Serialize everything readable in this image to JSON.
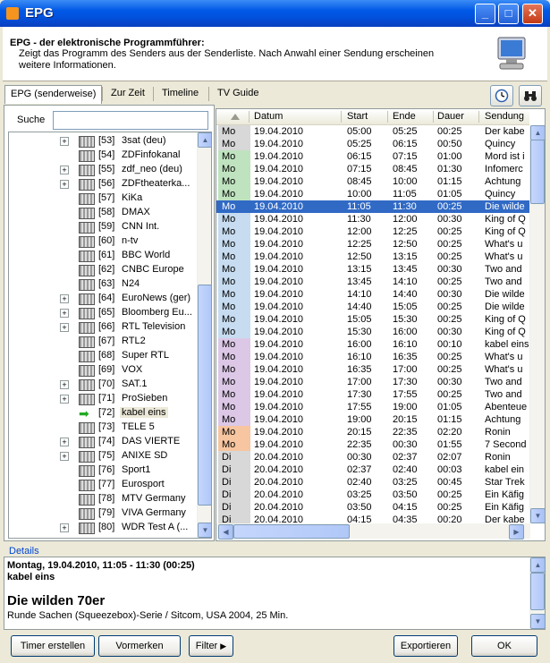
{
  "window": {
    "title": "EPG",
    "minimize": "_",
    "maximize": "□",
    "close": "✕"
  },
  "header": {
    "title": "EPG - der elektronische Programmführer:",
    "description": "Zeigt das Programm des Senders aus der Senderliste. Nach Anwahl einer Sendung erscheinen weitere Informationen."
  },
  "tabs": [
    "EPG (senderweise)",
    "Zur Zeit",
    "Timeline",
    "TV Guide"
  ],
  "toolbar_icons": {
    "clock": "clock-icon",
    "binoculars": "binoculars-icon"
  },
  "search": {
    "label": "Suche",
    "value": ""
  },
  "channels": [
    {
      "num": "[53]",
      "name": "3sat (deu)",
      "expand": true
    },
    {
      "num": "[54]",
      "name": "ZDFinfokanal",
      "expand": false
    },
    {
      "num": "[55]",
      "name": "zdf_neo (deu)",
      "expand": true
    },
    {
      "num": "[56]",
      "name": "ZDFtheaterka...",
      "expand": true
    },
    {
      "num": "[57]",
      "name": "KiKa",
      "expand": false
    },
    {
      "num": "[58]",
      "name": "DMAX",
      "expand": false
    },
    {
      "num": "[59]",
      "name": "CNN Int.",
      "expand": false
    },
    {
      "num": "[60]",
      "name": "n-tv",
      "expand": false
    },
    {
      "num": "[61]",
      "name": "BBC World",
      "expand": false
    },
    {
      "num": "[62]",
      "name": "CNBC Europe",
      "expand": false
    },
    {
      "num": "[63]",
      "name": "N24",
      "expand": false
    },
    {
      "num": "[64]",
      "name": "EuroNews (ger)",
      "expand": true
    },
    {
      "num": "[65]",
      "name": "Bloomberg Eu...",
      "expand": true
    },
    {
      "num": "[66]",
      "name": "RTL Television",
      "expand": true
    },
    {
      "num": "[67]",
      "name": "RTL2",
      "expand": false
    },
    {
      "num": "[68]",
      "name": "Super RTL",
      "expand": false
    },
    {
      "num": "[69]",
      "name": "VOX",
      "expand": false
    },
    {
      "num": "[70]",
      "name": "SAT.1",
      "expand": true
    },
    {
      "num": "[71]",
      "name": "ProSieben",
      "expand": true
    },
    {
      "num": "[72]",
      "name": "kabel eins",
      "expand": false,
      "selected": true
    },
    {
      "num": "[73]",
      "name": "TELE 5",
      "expand": false
    },
    {
      "num": "[74]",
      "name": "DAS VIERTE",
      "expand": true
    },
    {
      "num": "[75]",
      "name": "ANIXE SD",
      "expand": true
    },
    {
      "num": "[76]",
      "name": "Sport1",
      "expand": false
    },
    {
      "num": "[77]",
      "name": "Eurosport",
      "expand": false
    },
    {
      "num": "[78]",
      "name": "MTV Germany",
      "expand": false
    },
    {
      "num": "[79]",
      "name": "VIVA Germany",
      "expand": false
    },
    {
      "num": "[80]",
      "name": "WDR Test A (...",
      "expand": true
    }
  ],
  "grid": {
    "columns": [
      "Datum",
      "Start",
      "Ende",
      "Dauer",
      "Sendung"
    ],
    "rows": [
      {
        "day": "Mo",
        "date": "19.04.2010",
        "start": "05:00",
        "end": "05:25",
        "dur": "00:25",
        "show": "Der kabe",
        "color": "#d8d8d8"
      },
      {
        "day": "Mo",
        "date": "19.04.2010",
        "start": "05:25",
        "end": "06:15",
        "dur": "00:50",
        "show": "Quincy",
        "color": "#d8d8d8"
      },
      {
        "day": "Mo",
        "date": "19.04.2010",
        "start": "06:15",
        "end": "07:15",
        "dur": "01:00",
        "show": "Mord ist i",
        "color": "#bfe3bf"
      },
      {
        "day": "Mo",
        "date": "19.04.2010",
        "start": "07:15",
        "end": "08:45",
        "dur": "01:30",
        "show": "Infomerc",
        "color": "#bfe3bf"
      },
      {
        "day": "Mo",
        "date": "19.04.2010",
        "start": "08:45",
        "end": "10:00",
        "dur": "01:15",
        "show": "Achtung",
        "color": "#bfe3bf"
      },
      {
        "day": "Mo",
        "date": "19.04.2010",
        "start": "10:00",
        "end": "11:05",
        "dur": "01:05",
        "show": "Quincy",
        "color": "#bfe3bf"
      },
      {
        "day": "Mo",
        "date": "19.04.2010",
        "start": "11:05",
        "end": "11:30",
        "dur": "00:25",
        "show": "Die wilde",
        "color": "#316ac5",
        "selected": true
      },
      {
        "day": "Mo",
        "date": "19.04.2010",
        "start": "11:30",
        "end": "12:00",
        "dur": "00:30",
        "show": "King of Q",
        "color": "#c7dcf0"
      },
      {
        "day": "Mo",
        "date": "19.04.2010",
        "start": "12:00",
        "end": "12:25",
        "dur": "00:25",
        "show": "King of Q",
        "color": "#c7dcf0"
      },
      {
        "day": "Mo",
        "date": "19.04.2010",
        "start": "12:25",
        "end": "12:50",
        "dur": "00:25",
        "show": "What's u",
        "color": "#c7dcf0"
      },
      {
        "day": "Mo",
        "date": "19.04.2010",
        "start": "12:50",
        "end": "13:15",
        "dur": "00:25",
        "show": "What's u",
        "color": "#c7dcf0"
      },
      {
        "day": "Mo",
        "date": "19.04.2010",
        "start": "13:15",
        "end": "13:45",
        "dur": "00:30",
        "show": "Two and",
        "color": "#c7dcf0"
      },
      {
        "day": "Mo",
        "date": "19.04.2010",
        "start": "13:45",
        "end": "14:10",
        "dur": "00:25",
        "show": "Two and",
        "color": "#c7dcf0"
      },
      {
        "day": "Mo",
        "date": "19.04.2010",
        "start": "14:10",
        "end": "14:40",
        "dur": "00:30",
        "show": "Die wilde",
        "color": "#c7dcf0"
      },
      {
        "day": "Mo",
        "date": "19.04.2010",
        "start": "14:40",
        "end": "15:05",
        "dur": "00:25",
        "show": "Die wilde",
        "color": "#c7dcf0"
      },
      {
        "day": "Mo",
        "date": "19.04.2010",
        "start": "15:05",
        "end": "15:30",
        "dur": "00:25",
        "show": "King of Q",
        "color": "#c7dcf0"
      },
      {
        "day": "Mo",
        "date": "19.04.2010",
        "start": "15:30",
        "end": "16:00",
        "dur": "00:30",
        "show": "King of Q",
        "color": "#c7dcf0"
      },
      {
        "day": "Mo",
        "date": "19.04.2010",
        "start": "16:00",
        "end": "16:10",
        "dur": "00:10",
        "show": "kabel eins",
        "color": "#dcc8e6"
      },
      {
        "day": "Mo",
        "date": "19.04.2010",
        "start": "16:10",
        "end": "16:35",
        "dur": "00:25",
        "show": "What's u",
        "color": "#dcc8e6"
      },
      {
        "day": "Mo",
        "date": "19.04.2010",
        "start": "16:35",
        "end": "17:00",
        "dur": "00:25",
        "show": "What's u",
        "color": "#dcc8e6"
      },
      {
        "day": "Mo",
        "date": "19.04.2010",
        "start": "17:00",
        "end": "17:30",
        "dur": "00:30",
        "show": "Two and",
        "color": "#dcc8e6"
      },
      {
        "day": "Mo",
        "date": "19.04.2010",
        "start": "17:30",
        "end": "17:55",
        "dur": "00:25",
        "show": "Two and",
        "color": "#dcc8e6"
      },
      {
        "day": "Mo",
        "date": "19.04.2010",
        "start": "17:55",
        "end": "19:00",
        "dur": "01:05",
        "show": "Abenteue",
        "color": "#dcc8e6"
      },
      {
        "day": "Mo",
        "date": "19.04.2010",
        "start": "19:00",
        "end": "20:15",
        "dur": "01:15",
        "show": "Achtung",
        "color": "#dcc8e6"
      },
      {
        "day": "Mo",
        "date": "19.04.2010",
        "start": "20:15",
        "end": "22:35",
        "dur": "02:20",
        "show": "Ronin",
        "color": "#f7c59f"
      },
      {
        "day": "Mo",
        "date": "19.04.2010",
        "start": "22:35",
        "end": "00:30",
        "dur": "01:55",
        "show": "7 Second",
        "color": "#f7c59f"
      },
      {
        "day": "Di",
        "date": "20.04.2010",
        "start": "00:30",
        "end": "02:37",
        "dur": "02:07",
        "show": "Ronin",
        "color": "#d8d8d8"
      },
      {
        "day": "Di",
        "date": "20.04.2010",
        "start": "02:37",
        "end": "02:40",
        "dur": "00:03",
        "show": "kabel ein",
        "color": "#d8d8d8"
      },
      {
        "day": "Di",
        "date": "20.04.2010",
        "start": "02:40",
        "end": "03:25",
        "dur": "00:45",
        "show": "Star Trek",
        "color": "#d8d8d8"
      },
      {
        "day": "Di",
        "date": "20.04.2010",
        "start": "03:25",
        "end": "03:50",
        "dur": "00:25",
        "show": "Ein Käfig",
        "color": "#d8d8d8"
      },
      {
        "day": "Di",
        "date": "20.04.2010",
        "start": "03:50",
        "end": "04:15",
        "dur": "00:25",
        "show": "Ein Käfig",
        "color": "#d8d8d8"
      },
      {
        "day": "Di",
        "date": "20.04.2010",
        "start": "04:15",
        "end": "04:35",
        "dur": "00:20",
        "show": "Der kabe",
        "color": "#d8d8d8"
      }
    ]
  },
  "details": {
    "label": "Details",
    "line1": "Montag, 19.04.2010, 11:05 - 11:30  (00:25)",
    "line2": "kabel eins",
    "title": "Die wilden 70er",
    "info": "Runde Sachen (Squeezebox)-Serie / Sitcom, USA 2004, 25 Min."
  },
  "buttons": {
    "timer": "Timer erstellen",
    "mark": "Vormerken",
    "filter": "Filter",
    "export": "Exportieren",
    "ok": "OK"
  }
}
